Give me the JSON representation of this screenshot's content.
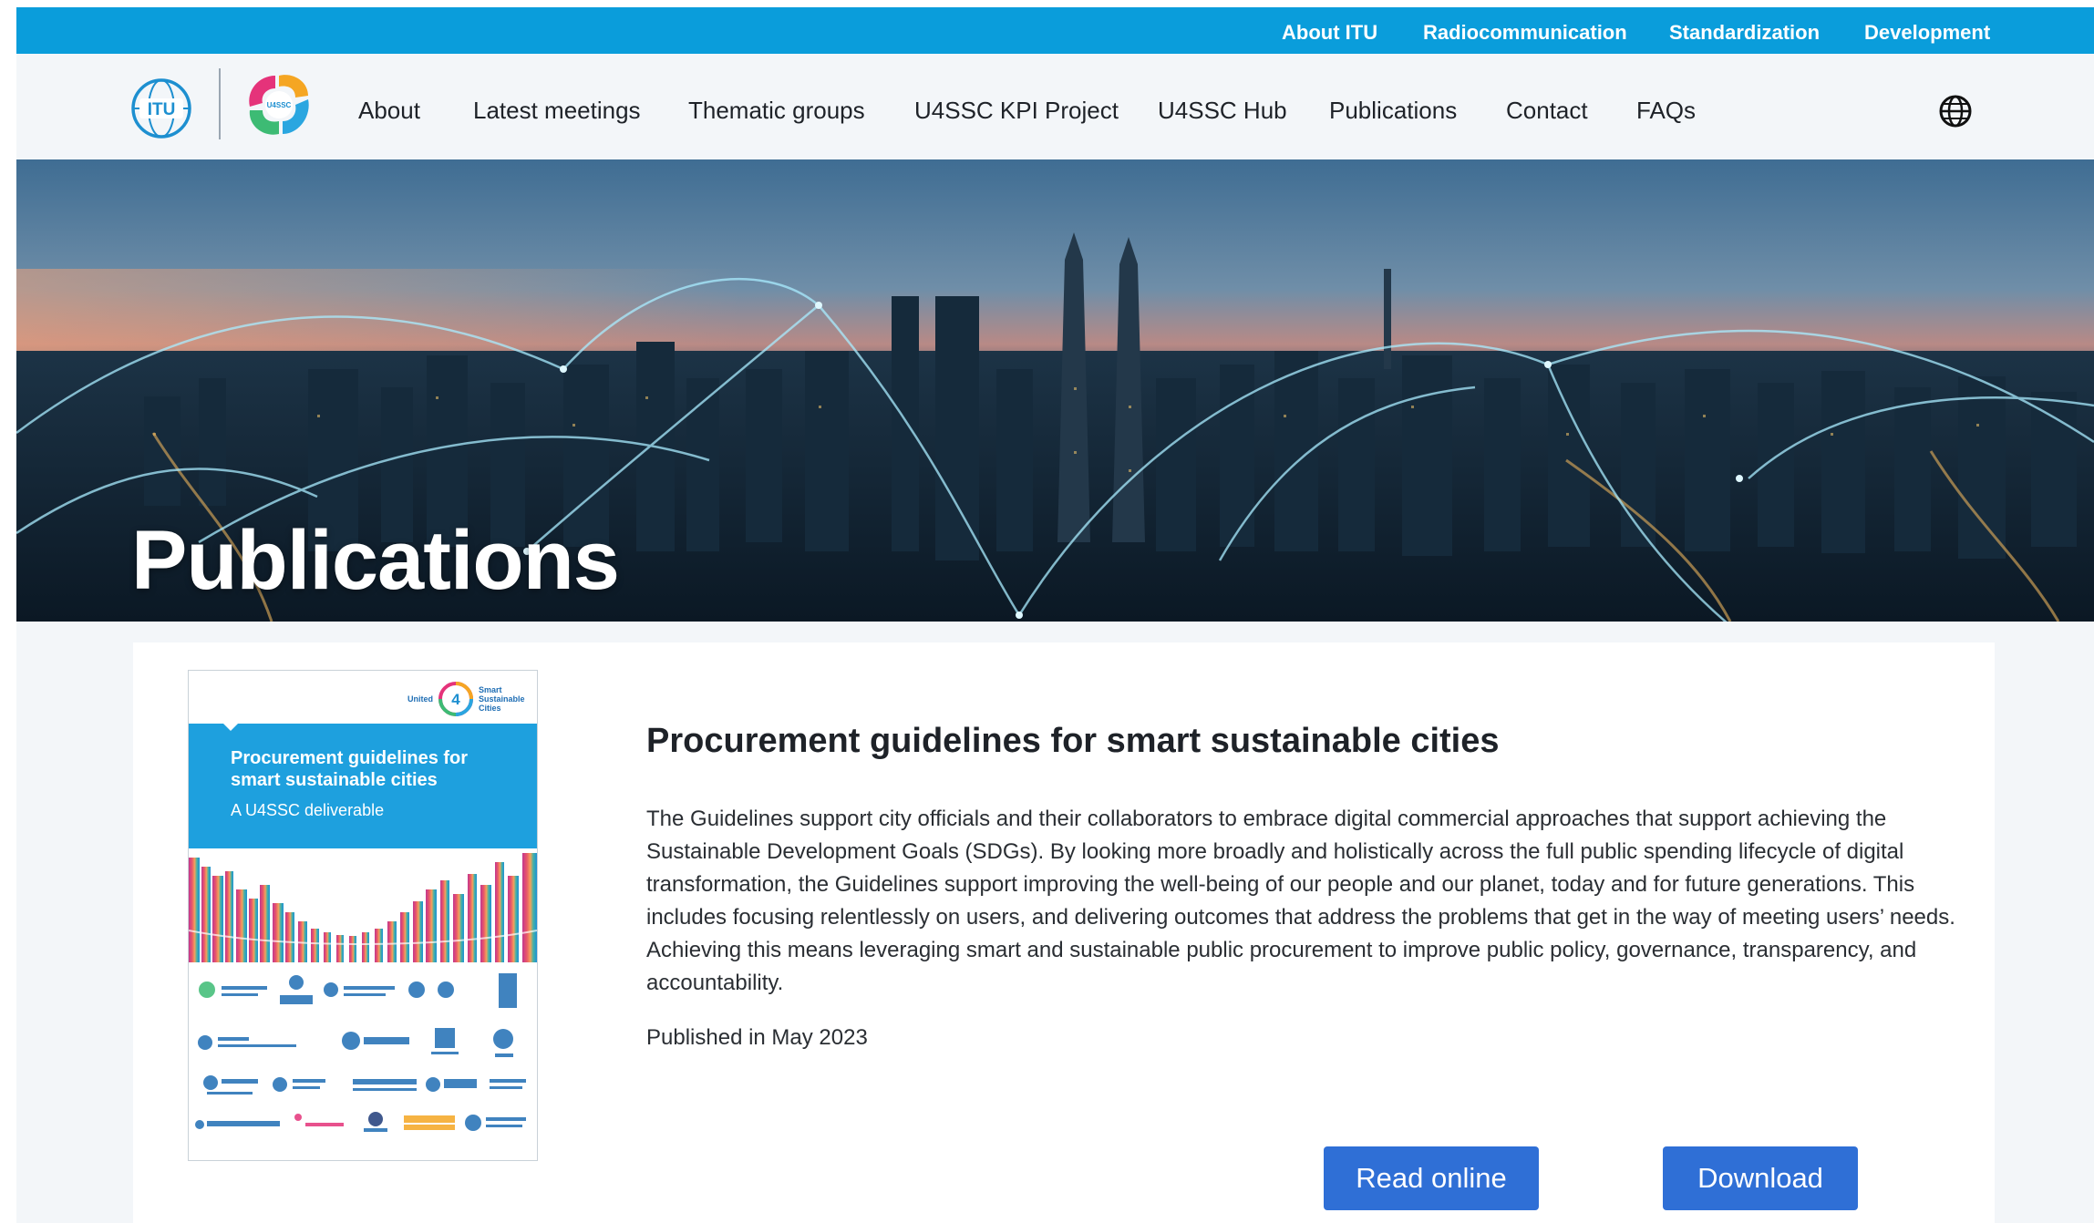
{
  "top_links": [
    "About ITU",
    "Radiocommunication",
    "Standardization",
    "Development"
  ],
  "logo_itu": "ITU",
  "logo_u4": "U4SSC",
  "nav": [
    "About",
    "Latest meetings",
    "Thematic groups",
    "U4SSC KPI Project",
    "U4SSC Hub",
    "Publications",
    "Contact",
    "FAQs"
  ],
  "hero": {
    "title": "Publications"
  },
  "publication": {
    "cover": {
      "brand_small": "United",
      "brand_number": "4",
      "brand_right": "Smart Sustainable Cities",
      "title": "Procurement guidelines for smart sustainable cities",
      "subtitle": "A U4SSC deliverable"
    },
    "title": "Procurement guidelines for smart sustainable cities",
    "description": "The Guidelines support city officials and their collaborators to embrace digital commercial approaches that support achieving the Sustainable Development Goals (SDGs). By looking more broadly and holistically across the full public spending lifecycle of digital transformation, the Guidelines support improving the well-being of our people and our planet, today and for future generations. This includes focusing relentlessly on users, and delivering outcomes that address the problems that get in the way of meeting users’ needs. Achieving this means leveraging smart and sustainable public procurement to improve public policy, governance, transparency, and accountability.",
    "published": "Published in May 2023",
    "read_label": "Read online",
    "download_label": "Download"
  },
  "colors": {
    "topbar": "#0a9ddb",
    "nav_bg": "#f3f6f9",
    "button": "#2f6fd6",
    "cover_band": "#1ea0de"
  },
  "icons": {
    "globe": "globe-icon"
  }
}
